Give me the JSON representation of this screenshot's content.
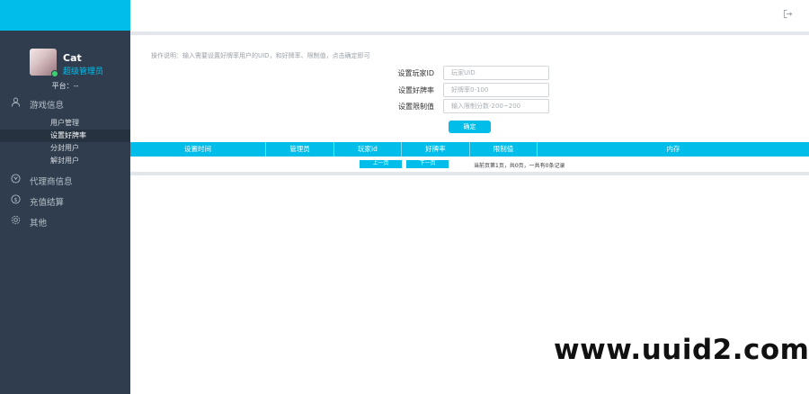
{
  "user": {
    "name": "Cat",
    "role": "超级管理员",
    "platform_label": "平台：",
    "platform_value": "--"
  },
  "sidebar": {
    "items": [
      {
        "label": "游戏信息",
        "icon": "user-icon"
      },
      {
        "label": "代理商信息",
        "icon": "agent-icon"
      },
      {
        "label": "充值结算",
        "icon": "dollar-icon"
      },
      {
        "label": "其他",
        "icon": "gear-icon"
      }
    ],
    "sub_items": [
      {
        "label": "用户管理"
      },
      {
        "label": "设置好牌率"
      },
      {
        "label": "分封用户"
      },
      {
        "label": "解封用户"
      }
    ]
  },
  "main": {
    "tip": "操作说明：输入需要设置好牌率用户的UID，和好牌率、限制值，点击确定即可",
    "form": {
      "player_id": {
        "label": "设置玩家ID",
        "placeholder": "玩家UID",
        "value": ""
      },
      "good_rate": {
        "label": "设置好牌率",
        "placeholder": "好牌率0-100",
        "value": ""
      },
      "limit": {
        "label": "设置限制值",
        "placeholder": "输入限制分数-200~200",
        "value": ""
      }
    },
    "confirm_label": "确定",
    "table": {
      "columns": [
        "设置时间",
        "管理员",
        "玩家id",
        "好牌率",
        "限制值",
        "内存"
      ]
    },
    "pager": {
      "prev_label": "上一页",
      "next_label": "下一页",
      "info": "当前页第1页，共0页，一共有0条记录"
    }
  },
  "watermark": "www.uuid2.com",
  "colors": {
    "accent": "#00bde9",
    "sidebar_bg": "#2f3d4e",
    "online": "#3bd16f"
  }
}
